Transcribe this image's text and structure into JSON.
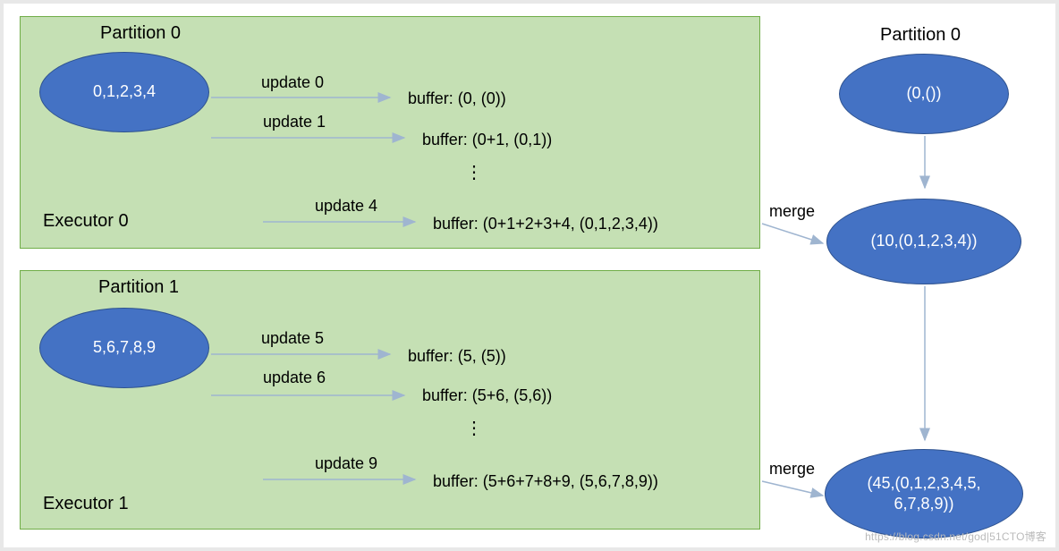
{
  "left": {
    "box0": {
      "title": "Partition 0",
      "executor": "Executor 0",
      "ellipse": "0,1,2,3,4",
      "updates": [
        {
          "label": "update 0",
          "buffer": "buffer: (0, (0))"
        },
        {
          "label": "update 1",
          "buffer": "buffer: (0+1, (0,1))"
        }
      ],
      "ellipsis": "⋮",
      "final": {
        "label": "update 4",
        "buffer": "buffer: (0+1+2+3+4, (0,1,2,3,4))"
      }
    },
    "box1": {
      "title": "Partition 1",
      "executor": "Executor 1",
      "ellipse": "5,6,7,8,9",
      "updates": [
        {
          "label": "update 5",
          "buffer": "buffer: (5, (5))"
        },
        {
          "label": "update 6",
          "buffer": "buffer: (5+6, (5,6))"
        }
      ],
      "ellipsis": "⋮",
      "final": {
        "label": "update 9",
        "buffer": "buffer: (5+6+7+8+9, (5,6,7,8,9))"
      }
    }
  },
  "right": {
    "title": "Partition 0",
    "e0": "(0,())",
    "e1": "(10,(0,1,2,3,4))",
    "e2": "(45,(0,1,2,3,4,5,\n6,7,8,9))",
    "merge0": "merge",
    "merge1": "merge"
  },
  "watermark": "https://blog.csdn.net/god|51CTO博客"
}
